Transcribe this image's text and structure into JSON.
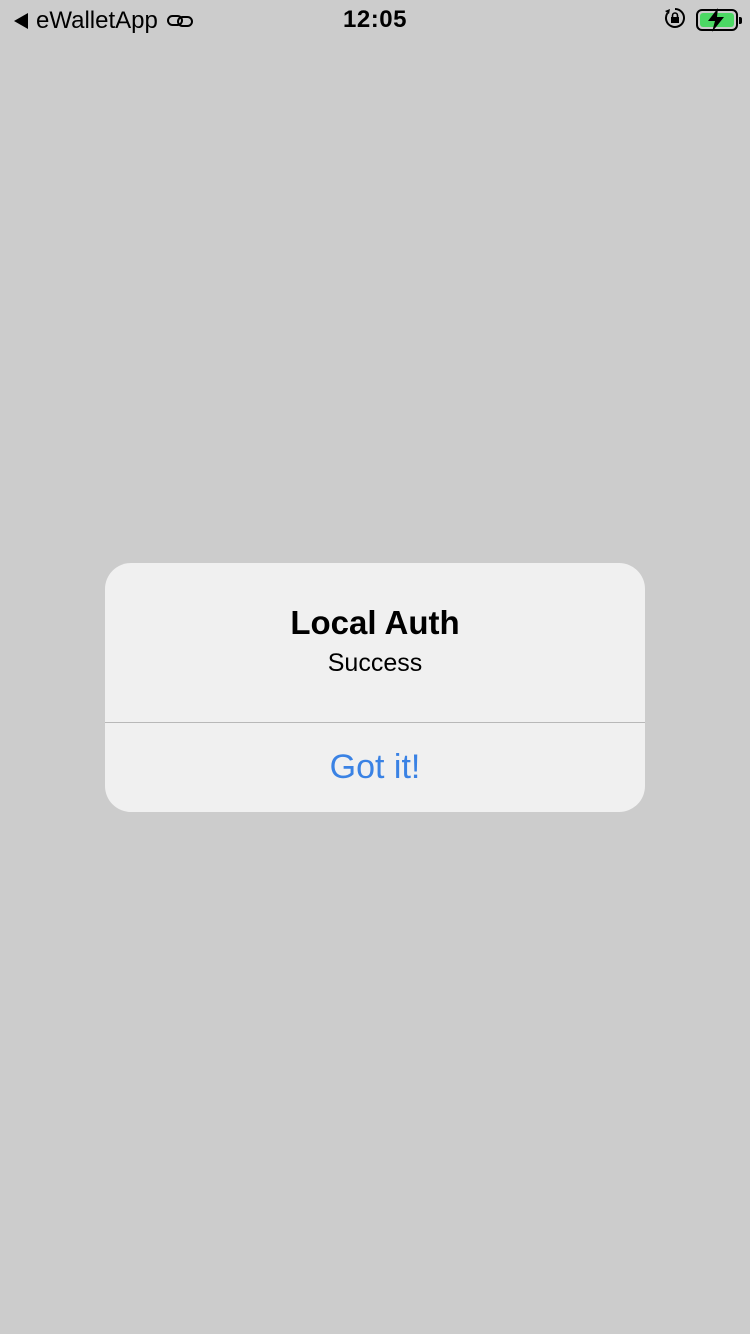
{
  "status_bar": {
    "back_app": "eWalletApp",
    "time": "12:05",
    "battery_color": "#4cd964"
  },
  "icons": {
    "back": "back-arrow-icon",
    "link": "link-icon",
    "orientation_lock": "orientation-lock-icon",
    "battery": "battery-charging-icon"
  },
  "alert": {
    "title": "Local Auth",
    "message": "Success",
    "button_label": "Got it!",
    "button_color": "#3a82e4"
  }
}
